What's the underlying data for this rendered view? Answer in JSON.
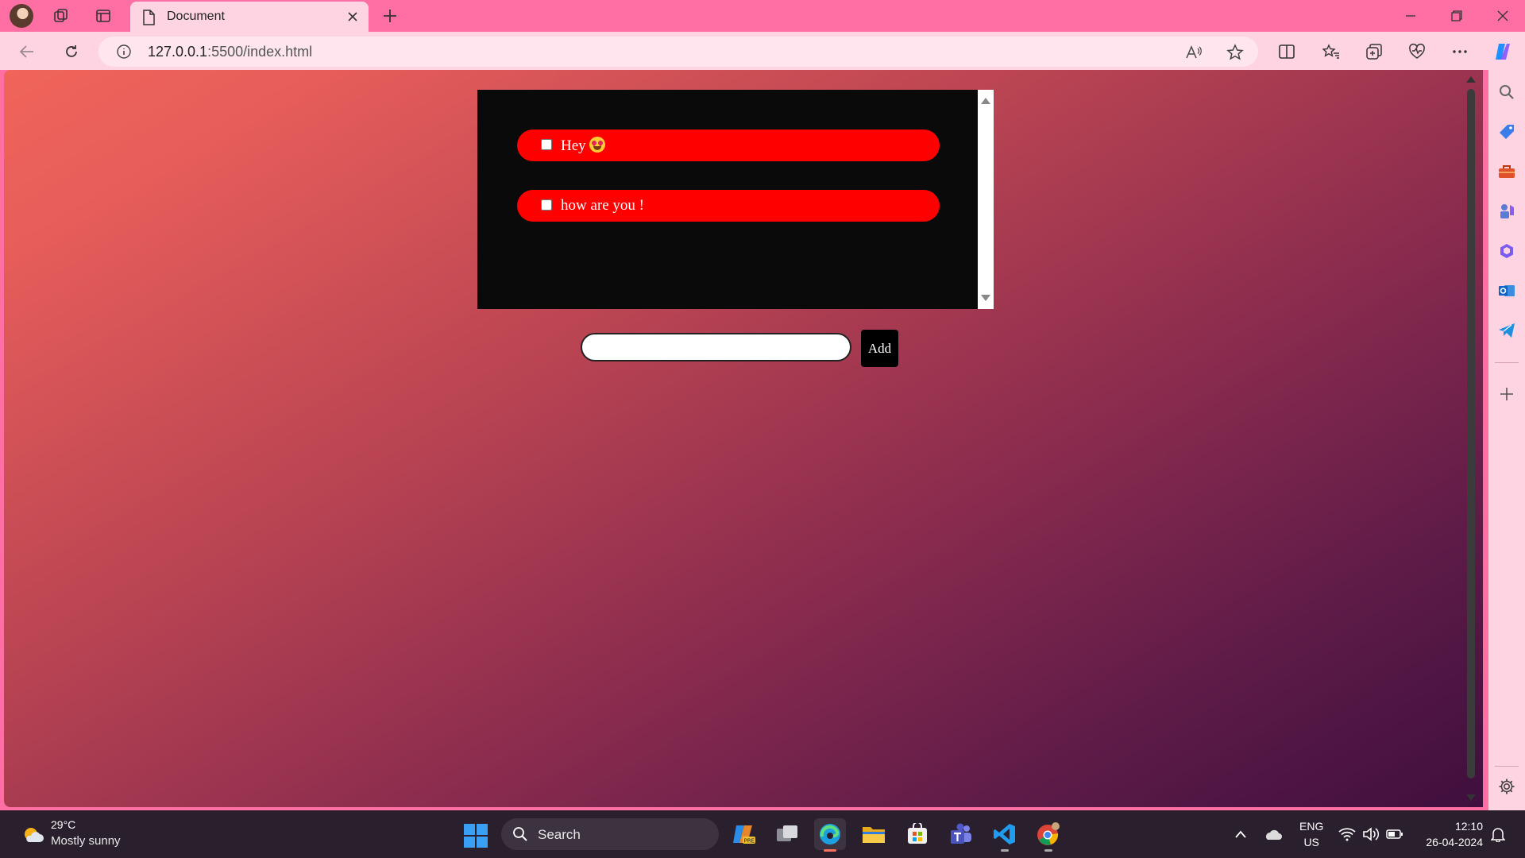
{
  "browser": {
    "tab_title": "Document",
    "url_host": "127.0.0.1",
    "url_path": ":5500/index.html"
  },
  "todo": {
    "items": [
      {
        "text": "Hey",
        "checked": false,
        "has_emoji": true
      },
      {
        "text": "how are you !",
        "checked": false,
        "has_emoji": false
      }
    ],
    "input_value": "",
    "add_label": "Add"
  },
  "taskbar": {
    "weather_temp": "29°C",
    "weather_desc": "Mostly sunny",
    "search_label": "Search",
    "lang_line1": "ENG",
    "lang_line2": "US",
    "time": "12:10",
    "date": "26-04-2024"
  },
  "colors": {
    "todo_item_bg": "#ff0000",
    "panel_bg": "#0a0a0a",
    "browser_chrome": "#ff6fa3"
  }
}
